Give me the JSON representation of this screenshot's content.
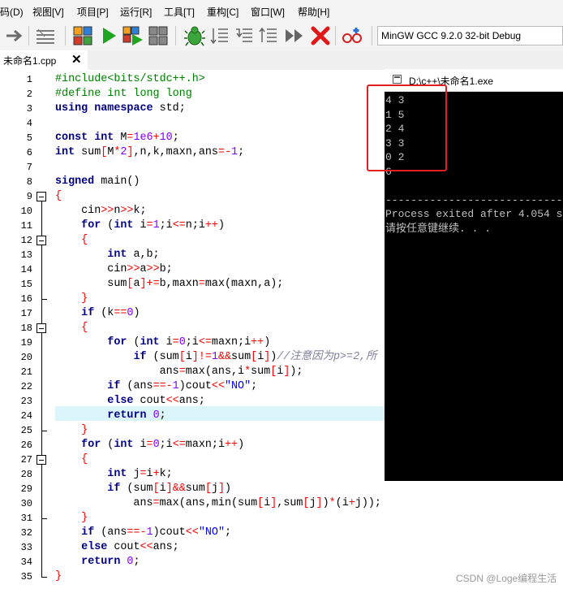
{
  "menu": [
    "码(D)",
    "视图[V]",
    "项目[P]",
    "运行[R]",
    "工具[T]",
    "重构[C]",
    "窗口[W]",
    "帮助[H]"
  ],
  "toolbar": {
    "compiler_selected": "MinGW GCC 9.2.0 32-bit Debug",
    "icons": [
      "goto-arrow-icon",
      "syntax-check-icon",
      "compile-icon",
      "run-icon",
      "compile-run-icon",
      "rebuild-icon",
      "debug-icon",
      "step-icon",
      "step-into-icon",
      "step-over-icon",
      "continue-icon",
      "stop-icon",
      "profile-icon"
    ]
  },
  "tab": {
    "label": "未命名1.cpp",
    "close": "✕"
  },
  "editor": {
    "line_numbers": [
      "1",
      "2",
      "3",
      "4",
      "5",
      "6",
      "7",
      "8",
      "9",
      "10",
      "11",
      "12",
      "13",
      "14",
      "15",
      "16",
      "17",
      "18",
      "19",
      "20",
      "21",
      "22",
      "23",
      "24",
      "25",
      "26",
      "27",
      "28",
      "29",
      "30",
      "31",
      "32",
      "33",
      "34",
      "35"
    ],
    "highlighted_line": "24",
    "lines": [
      [
        [
          "pp",
          "#include<bits/stdc++.h>"
        ]
      ],
      [
        [
          "pp",
          "#define int long long"
        ]
      ],
      [
        [
          "kw",
          "using"
        ],
        [
          "tx",
          " "
        ],
        [
          "kw",
          "namespace"
        ],
        [
          "tx",
          " std;"
        ]
      ],
      [],
      [
        [
          "kw",
          "const"
        ],
        [
          "tx",
          " "
        ],
        [
          "kw",
          "int"
        ],
        [
          "tx",
          " M"
        ],
        [
          "op",
          "="
        ],
        [
          "nm",
          "1e6"
        ],
        [
          "op",
          "+"
        ],
        [
          "nm",
          "10"
        ],
        [
          "tx",
          ";"
        ]
      ],
      [
        [
          "kw",
          "int"
        ],
        [
          "tx",
          " sum"
        ],
        [
          "op",
          "["
        ],
        [
          "tx",
          "M"
        ],
        [
          "op",
          "*"
        ],
        [
          "nm",
          "2"
        ],
        [
          "op",
          "]"
        ],
        [
          "tx",
          ",n,k,maxn,ans"
        ],
        [
          "op",
          "=-"
        ],
        [
          "nm",
          "1"
        ],
        [
          "tx",
          ";"
        ]
      ],
      [],
      [
        [
          "kw",
          "signed"
        ],
        [
          "tx",
          " main()"
        ]
      ],
      [
        [
          "op",
          "{"
        ]
      ],
      [
        [
          "tx",
          "    cin"
        ],
        [
          "op",
          ">>"
        ],
        [
          "tx",
          "n"
        ],
        [
          "op",
          ">>"
        ],
        [
          "tx",
          "k;"
        ]
      ],
      [
        [
          "tx",
          "    "
        ],
        [
          "kw",
          "for"
        ],
        [
          "tx",
          " ("
        ],
        [
          "kw",
          "int"
        ],
        [
          "tx",
          " i"
        ],
        [
          "op",
          "="
        ],
        [
          "nm",
          "1"
        ],
        [
          "tx",
          ";i"
        ],
        [
          "op",
          "<="
        ],
        [
          "tx",
          "n;i"
        ],
        [
          "op",
          "++"
        ],
        [
          "tx",
          ")"
        ]
      ],
      [
        [
          "tx",
          "    "
        ],
        [
          "op",
          "{"
        ]
      ],
      [
        [
          "tx",
          "        "
        ],
        [
          "kw",
          "int"
        ],
        [
          "tx",
          " a,b;"
        ]
      ],
      [
        [
          "tx",
          "        cin"
        ],
        [
          "op",
          ">>"
        ],
        [
          "tx",
          "a"
        ],
        [
          "op",
          ">>"
        ],
        [
          "tx",
          "b;"
        ]
      ],
      [
        [
          "tx",
          "        sum"
        ],
        [
          "op",
          "["
        ],
        [
          "tx",
          "a"
        ],
        [
          "op",
          "]+="
        ],
        [
          "tx",
          "b,maxn"
        ],
        [
          "op",
          "="
        ],
        [
          "tx",
          "max(maxn,a);"
        ]
      ],
      [
        [
          "tx",
          "    "
        ],
        [
          "op",
          "}"
        ]
      ],
      [
        [
          "tx",
          "    "
        ],
        [
          "kw",
          "if"
        ],
        [
          "tx",
          " (k"
        ],
        [
          "op",
          "=="
        ],
        [
          "nm",
          "0"
        ],
        [
          "tx",
          ")"
        ]
      ],
      [
        [
          "tx",
          "    "
        ],
        [
          "op",
          "{"
        ]
      ],
      [
        [
          "tx",
          "        "
        ],
        [
          "kw",
          "for"
        ],
        [
          "tx",
          " ("
        ],
        [
          "kw",
          "int"
        ],
        [
          "tx",
          " i"
        ],
        [
          "op",
          "="
        ],
        [
          "nm",
          "0"
        ],
        [
          "tx",
          ";i"
        ],
        [
          "op",
          "<="
        ],
        [
          "tx",
          "maxn;i"
        ],
        [
          "op",
          "++"
        ],
        [
          "tx",
          ")"
        ]
      ],
      [
        [
          "tx",
          "            "
        ],
        [
          "kw",
          "if"
        ],
        [
          "tx",
          " (sum"
        ],
        [
          "op",
          "["
        ],
        [
          "tx",
          "i"
        ],
        [
          "op",
          "]!="
        ],
        [
          "nm",
          "1"
        ],
        [
          "op",
          "&&"
        ],
        [
          "tx",
          "sum"
        ],
        [
          "op",
          "["
        ],
        [
          "tx",
          "i"
        ],
        [
          "op",
          "]"
        ],
        [
          "tx",
          ")"
        ],
        [
          "cm",
          "//注意因为p>=2,所"
        ]
      ],
      [
        [
          "tx",
          "                ans"
        ],
        [
          "op",
          "="
        ],
        [
          "tx",
          "max(ans,i"
        ],
        [
          "op",
          "*"
        ],
        [
          "tx",
          "sum"
        ],
        [
          "op",
          "["
        ],
        [
          "tx",
          "i"
        ],
        [
          "op",
          "]"
        ],
        [
          "tx",
          ");"
        ]
      ],
      [
        [
          "tx",
          "        "
        ],
        [
          "kw",
          "if"
        ],
        [
          "tx",
          " (ans"
        ],
        [
          "op",
          "==-"
        ],
        [
          "nm",
          "1"
        ],
        [
          "tx",
          ")cout"
        ],
        [
          "op",
          "<<"
        ],
        [
          "st",
          "\"NO\""
        ],
        [
          "tx",
          ";"
        ]
      ],
      [
        [
          "tx",
          "        "
        ],
        [
          "kw",
          "else"
        ],
        [
          "tx",
          " cout"
        ],
        [
          "op",
          "<<"
        ],
        [
          "tx",
          "ans;"
        ]
      ],
      [
        [
          "tx",
          "        "
        ],
        [
          "kw",
          "return"
        ],
        [
          "tx",
          " "
        ],
        [
          "nm",
          "0"
        ],
        [
          "tx",
          ";"
        ]
      ],
      [
        [
          "tx",
          "    "
        ],
        [
          "op",
          "}"
        ]
      ],
      [
        [
          "tx",
          "    "
        ],
        [
          "kw",
          "for"
        ],
        [
          "tx",
          " ("
        ],
        [
          "kw",
          "int"
        ],
        [
          "tx",
          " i"
        ],
        [
          "op",
          "="
        ],
        [
          "nm",
          "0"
        ],
        [
          "tx",
          ";i"
        ],
        [
          "op",
          "<="
        ],
        [
          "tx",
          "maxn;i"
        ],
        [
          "op",
          "++"
        ],
        [
          "tx",
          ")"
        ]
      ],
      [
        [
          "tx",
          "    "
        ],
        [
          "op",
          "{"
        ]
      ],
      [
        [
          "tx",
          "        "
        ],
        [
          "kw",
          "int"
        ],
        [
          "tx",
          " j"
        ],
        [
          "op",
          "="
        ],
        [
          "tx",
          "i"
        ],
        [
          "op",
          "+"
        ],
        [
          "tx",
          "k;"
        ]
      ],
      [
        [
          "tx",
          "        "
        ],
        [
          "kw",
          "if"
        ],
        [
          "tx",
          " (sum"
        ],
        [
          "op",
          "["
        ],
        [
          "tx",
          "i"
        ],
        [
          "op",
          "]&&"
        ],
        [
          "tx",
          "sum"
        ],
        [
          "op",
          "["
        ],
        [
          "tx",
          "j"
        ],
        [
          "op",
          "]"
        ],
        [
          "tx",
          ")"
        ]
      ],
      [
        [
          "tx",
          "            ans"
        ],
        [
          "op",
          "="
        ],
        [
          "tx",
          "max(ans,min(sum"
        ],
        [
          "op",
          "["
        ],
        [
          "tx",
          "i"
        ],
        [
          "op",
          "]"
        ],
        [
          "tx",
          ",sum"
        ],
        [
          "op",
          "["
        ],
        [
          "tx",
          "j"
        ],
        [
          "op",
          "]"
        ],
        [
          "tx",
          ")"
        ],
        [
          "op",
          "*"
        ],
        [
          "tx",
          "(i"
        ],
        [
          "op",
          "+"
        ],
        [
          "tx",
          "j));"
        ]
      ],
      [
        [
          "tx",
          "    "
        ],
        [
          "op",
          "}"
        ]
      ],
      [
        [
          "tx",
          "    "
        ],
        [
          "kw",
          "if"
        ],
        [
          "tx",
          " (ans"
        ],
        [
          "op",
          "==-"
        ],
        [
          "nm",
          "1"
        ],
        [
          "tx",
          ")cout"
        ],
        [
          "op",
          "<<"
        ],
        [
          "st",
          "\"NO\""
        ],
        [
          "tx",
          ";"
        ]
      ],
      [
        [
          "tx",
          "    "
        ],
        [
          "kw",
          "else"
        ],
        [
          "tx",
          " cout"
        ],
        [
          "op",
          "<<"
        ],
        [
          "tx",
          "ans;"
        ]
      ],
      [
        [
          "tx",
          "    "
        ],
        [
          "kw",
          "return"
        ],
        [
          "tx",
          " "
        ],
        [
          "nm",
          "0"
        ],
        [
          "tx",
          ";"
        ]
      ],
      [
        [
          "op",
          "}"
        ]
      ]
    ]
  },
  "console": {
    "title": "D:\\c++\\未命名1.exe",
    "lines": [
      "4 3",
      "1 5",
      "2 4",
      "3 3",
      "0 2",
      "6",
      "",
      "--------------------------------",
      "Process exited after 4.054 s",
      "请按任意键继续. . ."
    ]
  },
  "watermark": "CSDN @Loge编程生活"
}
